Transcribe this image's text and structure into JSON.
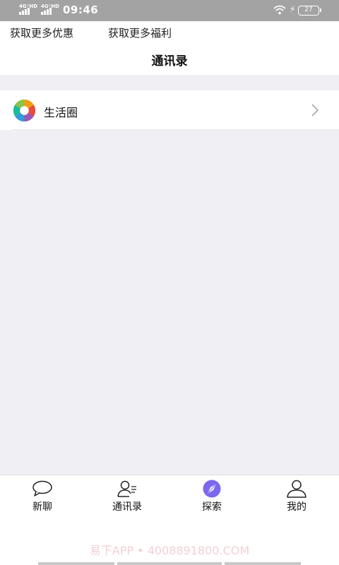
{
  "status_bar": {
    "signal_1_tag": "4G⁺HD",
    "signal_2_tag": "4G⁺HD",
    "time": "09:46",
    "battery": "27",
    "icons": [
      "signal-icon",
      "wifi-icon",
      "charging-icon",
      "battery-icon"
    ]
  },
  "header": {
    "promo_link_1": "获取更多优惠",
    "promo_link_2": "获取更多福利",
    "title": "通讯录"
  },
  "list": {
    "items": [
      {
        "label": "生活圈",
        "icon": "moments-icon"
      }
    ]
  },
  "tabbar": {
    "tabs": [
      {
        "label": "新聊",
        "icon": "chat-bubble-icon"
      },
      {
        "label": "通讯录",
        "icon": "contacts-icon"
      },
      {
        "label": "探索",
        "icon": "compass-icon",
        "active": true
      },
      {
        "label": "我的",
        "icon": "person-icon"
      }
    ],
    "active_color": "#7b68ee"
  },
  "watermark": "易下APP • 4008891800.COM"
}
